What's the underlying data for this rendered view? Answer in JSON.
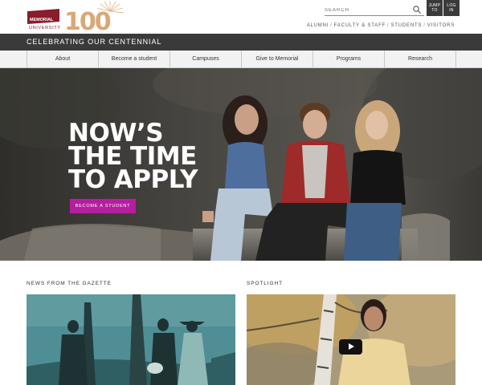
{
  "brand": {
    "logo_word_top": "MEMORIAL",
    "logo_word_bottom": "UNIVERSITY",
    "logo_number": "100",
    "maroon": "#8a1c2b",
    "gold": "#d9a877"
  },
  "header": {
    "search_placeholder": "SEARCH",
    "search_icon": "search-icon",
    "jump_to_line1": "JUMP",
    "jump_to_line2": "TO",
    "log_in_line1": "LOG",
    "log_in_line2": "IN",
    "audience_links": [
      "ALUMNI",
      "FACULTY & STAFF",
      "STUDENTS",
      "VISITORS"
    ],
    "audience_separator": "/"
  },
  "banner": {
    "text": "CELEBRATING OUR CENTENNIAL"
  },
  "nav": {
    "items": [
      "About",
      "Become a student",
      "Campuses",
      "Give to Memorial",
      "Programs",
      "Research"
    ]
  },
  "hero": {
    "headline_lines": [
      "NOW’S",
      "THE TIME",
      "TO APPLY"
    ],
    "cta_label": "BECOME A STUDENT",
    "cta_color": "#b51e9f"
  },
  "sections": {
    "news_label": "NEWS FROM THE GAZETTE",
    "spotlight_label": "SPOTLIGHT",
    "play_icon": "play-icon"
  }
}
